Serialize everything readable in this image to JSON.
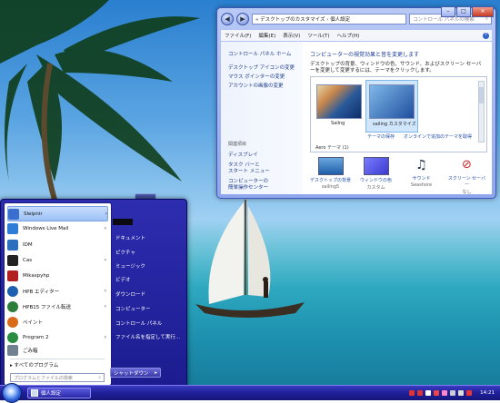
{
  "window": {
    "address": "« デスクトップのカスタマイズ › 個人設定",
    "search_placeholder": "コントロール パネルの検索",
    "menu": [
      "ファイル(F)",
      "編集(E)",
      "表示(V)",
      "ツール(T)",
      "ヘルプ(H)"
    ],
    "left_links": [
      "コントロール パネル ホーム",
      "デスクトップ アイコンの変更",
      "マウス ポインターの変更",
      "アカウントの画像の変更"
    ],
    "see_also_header": "関連項目",
    "see_also": [
      "ディスプレイ",
      "タスク バーと",
      "スタート メニュー",
      "コンピューターの",
      "簡単操作センター"
    ],
    "main_title": "コンピューターの視覚効果と音を変更します",
    "main_desc": "デスクトップの背景、ウィンドウの色、サウンド、およびスクリーン セーバーを変更して変更するには、テーマをクリックします。",
    "themes": [
      {
        "label": "Sailng"
      },
      {
        "label": "sailing カスタマイズ"
      }
    ],
    "theme_save_link": "テーマの保存",
    "theme_online_link": "オンラインで追加のテーマを取得",
    "aero_label": "Aero テーマ (1)",
    "bottom_items": [
      {
        "title": "デスクトップの背景",
        "sub": "sailing5",
        "icon": "desktop-background-icon"
      },
      {
        "title": "ウィンドウの色",
        "sub": "カスタム",
        "icon": "window-color-icon"
      },
      {
        "title": "サウンド",
        "sub": "Seashore",
        "icon": "sound-icon"
      },
      {
        "title": "スクリーン セーバー",
        "sub": "なし",
        "icon": "screensaver-icon"
      }
    ]
  },
  "start_menu": {
    "programs": [
      {
        "label": "Sleipnir",
        "arrow": "›",
        "color": "#3a6fd0"
      },
      {
        "label": "Windows Live Mail",
        "arrow": "›",
        "color": "#2d7cd8"
      },
      {
        "label": "IDM",
        "arrow": "",
        "color": "#2d6fbf"
      },
      {
        "label": "Cas",
        "arrow": "›",
        "color": "#222"
      },
      {
        "label": "Mikaspyhp",
        "arrow": "",
        "color": "#b02020"
      },
      {
        "label": "HPB エディター",
        "arrow": "›",
        "color": "#1d5fb0"
      },
      {
        "label": "HPB15 ファイル転送",
        "arrow": "›",
        "color": "#2c7d3a"
      },
      {
        "label": "ペイント",
        "arrow": "",
        "color": "#d86a1a"
      },
      {
        "label": "Program 2",
        "arrow": "›",
        "color": "#2a8c40"
      },
      {
        "label": "ごみ箱",
        "arrow": "",
        "color": "#708090"
      }
    ],
    "all_programs": "▸  すべてのプログラム",
    "search_placeholder": "プログラムとファイルの検索",
    "right_items": [
      "ドキュメント",
      "ピクチャ",
      "ミュージック",
      "ビデオ",
      "ダウンロード",
      "コンピューター",
      "コントロール パネル",
      "ファイル名を指定して実行..."
    ],
    "shutdown_label": "シャットダウン",
    "shutdown_arrow": "▸"
  },
  "taskbar": {
    "task_label": "個人設定",
    "clock": "14:21"
  }
}
